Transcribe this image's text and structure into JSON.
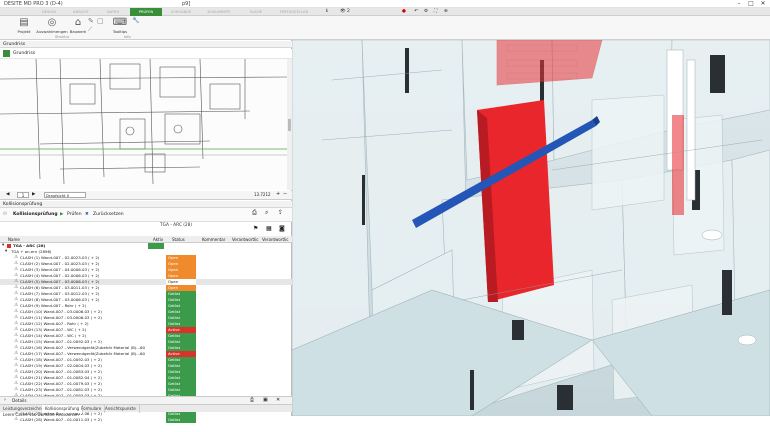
{
  "app": {
    "title": "DESITE MD PRO 3 (D-4)",
    "document": "p9]"
  },
  "ribbon_tabs": [
    "DESIGN",
    "ANSICHT",
    "DATEN",
    "PRÜFEN",
    "VORGÄNGE",
    "DOKUMENTE",
    "SUCHE",
    "FERTIGSTELLEN"
  ],
  "ribbon_status": {
    "count": "2"
  },
  "ribbon_buttons": [
    {
      "label": "Projekt",
      "icon": "project-icon"
    },
    {
      "label": "Auswahlmengen",
      "icon": "selection-sets-icon"
    },
    {
      "label": "Bauwerk",
      "icon": "building-icon"
    },
    {
      "label": "Tooltips",
      "icon": "tooltips-icon"
    }
  ],
  "ribbon_groups": [
    "Struktur",
    "Info"
  ],
  "grundriss": {
    "panel_title": "Grundriss",
    "sub_title": "Grundriss",
    "page": "1",
    "view_select": "Draufsicht 0",
    "zoom": "13.7212"
  },
  "kollision": {
    "panel_title": "Kollisionsprüfung",
    "title": "Kollisionsprüfung",
    "pruefen": "Prüfen",
    "zuruecksetzen": "Zurücksetzen",
    "result_count": "TGA - ARC (28)",
    "columns": [
      "Name",
      "Aktiv",
      "Status",
      "Kommentar",
      "Verantwortlic",
      "Verantwortlic"
    ],
    "root": "TGA - ARC (28)",
    "group": "TGA + an.ern (2898)",
    "rows": [
      {
        "name": "CLASH (1) Wand-007 - 02.0023.03 ( + 2)",
        "status": "Open",
        "color": "#ef8b2c"
      },
      {
        "name": "CLASH (2) Wand-007 - 02.0023.03 ( + 2)",
        "status": "Open",
        "color": "#ef8b2c"
      },
      {
        "name": "CLASH (3) Wand-007 - 04.0006.03 ( + 2)",
        "status": "Open",
        "color": "#ef8b2c"
      },
      {
        "name": "CLASH (4) Wand-007 - 02.0006.03 ( + 2)",
        "status": "Open",
        "color": "#ef8b2c"
      },
      {
        "name": "CLASH (5) Wand-007 - 03.0006.03 ( + 2)",
        "status": "Open",
        "color": "#ffffff"
      },
      {
        "name": "CLASH (6) Wand-007 - 03.0011.03 ( + 2)",
        "status": "Open",
        "color": "#ef8b2c"
      },
      {
        "name": "CLASH (7) Wand-007 - 03.0012.03 ( + 2)",
        "status": "Gelöst",
        "color": "#3b9b4a"
      },
      {
        "name": "CLASH (8) Wand-007 - 03.0006.03 ( + 2)",
        "status": "Gelöst",
        "color": "#3b9b4a"
      },
      {
        "name": "CLASH (9) Wand-007 - Rohr ( + 2)",
        "status": "Gelöst",
        "color": "#3b9b4a"
      },
      {
        "name": "CLASH (10) Wand-007 - 03.0006.03 ( + 2)",
        "status": "Gelöst",
        "color": "#3b9b4a"
      },
      {
        "name": "CLASH (11) Wand-007 - 03.0006.03 ( + 2)",
        "status": "Gelöst",
        "color": "#3b9b4a"
      },
      {
        "name": "CLASH (12) Wand-007 - Rohr ( + 2)",
        "status": "Gelöst",
        "color": "#3b9b4a"
      },
      {
        "name": "CLASH (13) Wand-007 - WC ( + 2)",
        "status": "Active",
        "color": "#d9322b"
      },
      {
        "name": "CLASH (14) Wand-007 - WC ( + 2)",
        "status": "Gelöst",
        "color": "#3b9b4a"
      },
      {
        "name": "CLASH (15) Wand-007 - 01.0092.03 ( + 2)",
        "status": "Gelöst",
        "color": "#3b9b4a"
      },
      {
        "name": "CLASH (16) Wand-007 - Verwendgerät(Zubehör Material (B)...60",
        "status": "Gelöst",
        "color": "#3b9b4a"
      },
      {
        "name": "CLASH (17) Wand-007 - Verwendgerät(Zubehör Material (B)...60",
        "status": "Active",
        "color": "#d9322b"
      },
      {
        "name": "CLASH (18) Wand-007 - 01.0092.03 ( + 2)",
        "status": "Gelöst",
        "color": "#3b9b4a"
      },
      {
        "name": "CLASH (19) Wand-007 - 02.0004.03 ( + 2)",
        "status": "Gelöst",
        "color": "#3b9b4a"
      },
      {
        "name": "CLASH (20) Wand-007 - 01.0083.03 ( + 2)",
        "status": "Gelöst",
        "color": "#3b9b4a"
      },
      {
        "name": "CLASH (21) Wand-007 - 01.0082.04 ( + 2)",
        "status": "Gelöst",
        "color": "#3b9b4a"
      },
      {
        "name": "CLASH (22) Wand-007 - 01.0079.03 ( + 2)",
        "status": "Gelöst",
        "color": "#3b9b4a"
      },
      {
        "name": "CLASH (23) Wand-007 - 01.0081.03 ( + 2)",
        "status": "Gelöst",
        "color": "#3b9b4a"
      },
      {
        "name": "CLASH (24) Wand-007 - 01.0093.03 ( + 2)",
        "status": "Gelöst",
        "color": "#3b9b4a"
      },
      {
        "name": "CLASH (25) Wand-007 - 01.0013.03 ( + 2)",
        "status": "Gelöst",
        "color": "#3b9b4a"
      },
      {
        "name": "CLASH (26) Wand-007 - 01.0012.06 ( + 2)",
        "status": "Gelöst",
        "color": "#3b9b4a"
      },
      {
        "name": "CLASH (27) Wand-007 - 01.0012.06 ( + 2)",
        "status": "Gelöst",
        "color": "#3b9b4a"
      },
      {
        "name": "CLASH (28) Wand-007 - 01.0011.03 ( + 2)",
        "status": "Gelöst",
        "color": "#3b9b4a"
      }
    ],
    "details": "Details"
  },
  "bottom_tabs": [
    "Leistungsverzeichnis",
    "Kollisionsprüfung",
    "Formulare",
    "Ansichtspunkte"
  ],
  "status_text": "Leere Cache von Domäne Ressourcen"
}
